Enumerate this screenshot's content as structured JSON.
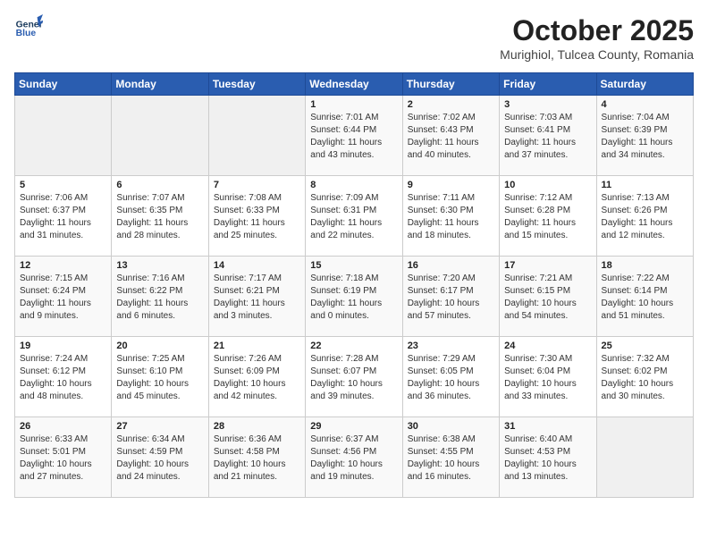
{
  "header": {
    "logo_line1": "General",
    "logo_line2": "Blue",
    "month": "October 2025",
    "location": "Murighiol, Tulcea County, Romania"
  },
  "days_of_week": [
    "Sunday",
    "Monday",
    "Tuesday",
    "Wednesday",
    "Thursday",
    "Friday",
    "Saturday"
  ],
  "weeks": [
    [
      {
        "day": "",
        "info": ""
      },
      {
        "day": "",
        "info": ""
      },
      {
        "day": "",
        "info": ""
      },
      {
        "day": "1",
        "info": "Sunrise: 7:01 AM\nSunset: 6:44 PM\nDaylight: 11 hours\nand 43 minutes."
      },
      {
        "day": "2",
        "info": "Sunrise: 7:02 AM\nSunset: 6:43 PM\nDaylight: 11 hours\nand 40 minutes."
      },
      {
        "day": "3",
        "info": "Sunrise: 7:03 AM\nSunset: 6:41 PM\nDaylight: 11 hours\nand 37 minutes."
      },
      {
        "day": "4",
        "info": "Sunrise: 7:04 AM\nSunset: 6:39 PM\nDaylight: 11 hours\nand 34 minutes."
      }
    ],
    [
      {
        "day": "5",
        "info": "Sunrise: 7:06 AM\nSunset: 6:37 PM\nDaylight: 11 hours\nand 31 minutes."
      },
      {
        "day": "6",
        "info": "Sunrise: 7:07 AM\nSunset: 6:35 PM\nDaylight: 11 hours\nand 28 minutes."
      },
      {
        "day": "7",
        "info": "Sunrise: 7:08 AM\nSunset: 6:33 PM\nDaylight: 11 hours\nand 25 minutes."
      },
      {
        "day": "8",
        "info": "Sunrise: 7:09 AM\nSunset: 6:31 PM\nDaylight: 11 hours\nand 22 minutes."
      },
      {
        "day": "9",
        "info": "Sunrise: 7:11 AM\nSunset: 6:30 PM\nDaylight: 11 hours\nand 18 minutes."
      },
      {
        "day": "10",
        "info": "Sunrise: 7:12 AM\nSunset: 6:28 PM\nDaylight: 11 hours\nand 15 minutes."
      },
      {
        "day": "11",
        "info": "Sunrise: 7:13 AM\nSunset: 6:26 PM\nDaylight: 11 hours\nand 12 minutes."
      }
    ],
    [
      {
        "day": "12",
        "info": "Sunrise: 7:15 AM\nSunset: 6:24 PM\nDaylight: 11 hours\nand 9 minutes."
      },
      {
        "day": "13",
        "info": "Sunrise: 7:16 AM\nSunset: 6:22 PM\nDaylight: 11 hours\nand 6 minutes."
      },
      {
        "day": "14",
        "info": "Sunrise: 7:17 AM\nSunset: 6:21 PM\nDaylight: 11 hours\nand 3 minutes."
      },
      {
        "day": "15",
        "info": "Sunrise: 7:18 AM\nSunset: 6:19 PM\nDaylight: 11 hours\nand 0 minutes."
      },
      {
        "day": "16",
        "info": "Sunrise: 7:20 AM\nSunset: 6:17 PM\nDaylight: 10 hours\nand 57 minutes."
      },
      {
        "day": "17",
        "info": "Sunrise: 7:21 AM\nSunset: 6:15 PM\nDaylight: 10 hours\nand 54 minutes."
      },
      {
        "day": "18",
        "info": "Sunrise: 7:22 AM\nSunset: 6:14 PM\nDaylight: 10 hours\nand 51 minutes."
      }
    ],
    [
      {
        "day": "19",
        "info": "Sunrise: 7:24 AM\nSunset: 6:12 PM\nDaylight: 10 hours\nand 48 minutes."
      },
      {
        "day": "20",
        "info": "Sunrise: 7:25 AM\nSunset: 6:10 PM\nDaylight: 10 hours\nand 45 minutes."
      },
      {
        "day": "21",
        "info": "Sunrise: 7:26 AM\nSunset: 6:09 PM\nDaylight: 10 hours\nand 42 minutes."
      },
      {
        "day": "22",
        "info": "Sunrise: 7:28 AM\nSunset: 6:07 PM\nDaylight: 10 hours\nand 39 minutes."
      },
      {
        "day": "23",
        "info": "Sunrise: 7:29 AM\nSunset: 6:05 PM\nDaylight: 10 hours\nand 36 minutes."
      },
      {
        "day": "24",
        "info": "Sunrise: 7:30 AM\nSunset: 6:04 PM\nDaylight: 10 hours\nand 33 minutes."
      },
      {
        "day": "25",
        "info": "Sunrise: 7:32 AM\nSunset: 6:02 PM\nDaylight: 10 hours\nand 30 minutes."
      }
    ],
    [
      {
        "day": "26",
        "info": "Sunrise: 6:33 AM\nSunset: 5:01 PM\nDaylight: 10 hours\nand 27 minutes."
      },
      {
        "day": "27",
        "info": "Sunrise: 6:34 AM\nSunset: 4:59 PM\nDaylight: 10 hours\nand 24 minutes."
      },
      {
        "day": "28",
        "info": "Sunrise: 6:36 AM\nSunset: 4:58 PM\nDaylight: 10 hours\nand 21 minutes."
      },
      {
        "day": "29",
        "info": "Sunrise: 6:37 AM\nSunset: 4:56 PM\nDaylight: 10 hours\nand 19 minutes."
      },
      {
        "day": "30",
        "info": "Sunrise: 6:38 AM\nSunset: 4:55 PM\nDaylight: 10 hours\nand 16 minutes."
      },
      {
        "day": "31",
        "info": "Sunrise: 6:40 AM\nSunset: 4:53 PM\nDaylight: 10 hours\nand 13 minutes."
      },
      {
        "day": "",
        "info": ""
      }
    ]
  ]
}
